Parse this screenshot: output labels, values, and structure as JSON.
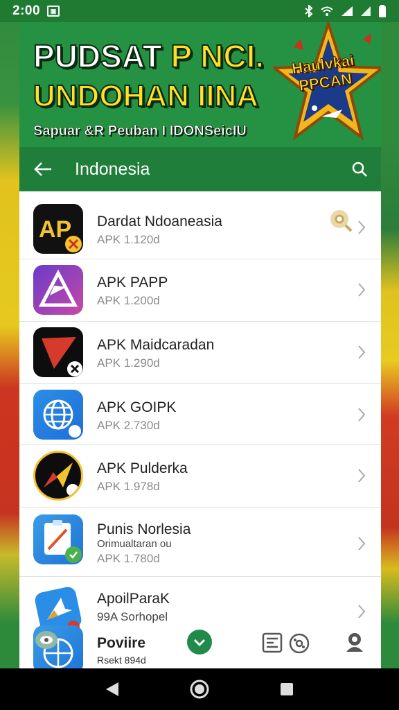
{
  "status": {
    "time": "2:00"
  },
  "banner": {
    "line1_a": "PUDSAT ",
    "line1_b": "P NCI.",
    "line2": "UNDOHAN IINA",
    "line3": "Sapuar &R Peuban I IDONSeicIU",
    "star_line1": "Haulvkai",
    "star_line2": "PPCAN"
  },
  "appbar": {
    "title": "Indonesia"
  },
  "apps": [
    {
      "name": "Dardat Ndoaneasia",
      "version": "APK 1.120d",
      "icon": "ap-logo-icon"
    },
    {
      "name": "APK PAPP",
      "version": "APK 1.200d",
      "icon": "triangle-logo-icon"
    },
    {
      "name": "APK Maidcaradan",
      "version": "APK 1.290d",
      "icon": "red-arrow-icon"
    },
    {
      "name": "APK GOIPK",
      "version": "APK 2.730d",
      "icon": "globe-icon"
    },
    {
      "name": "APK Pulderka",
      "version": "APK 1.978d",
      "icon": "yellow-arrow-icon"
    },
    {
      "name": "Punis Norlesia",
      "subtitle": "Orimualtaran ou",
      "version": "APK 1.780d",
      "icon": "clipboard-icon"
    },
    {
      "name": "ApoilParaK",
      "version": "99A Sorhopel",
      "icon": "blue-star-icon"
    },
    {
      "name": "Poviire",
      "version": "Rsekt 894d",
      "icon": "globe-blue-icon"
    }
  ],
  "colors": {
    "primary_green": "#1f7e3a",
    "banner_green": "#259243",
    "accent_yellow": "#ffe12a",
    "list_bg": "#ffffff"
  }
}
